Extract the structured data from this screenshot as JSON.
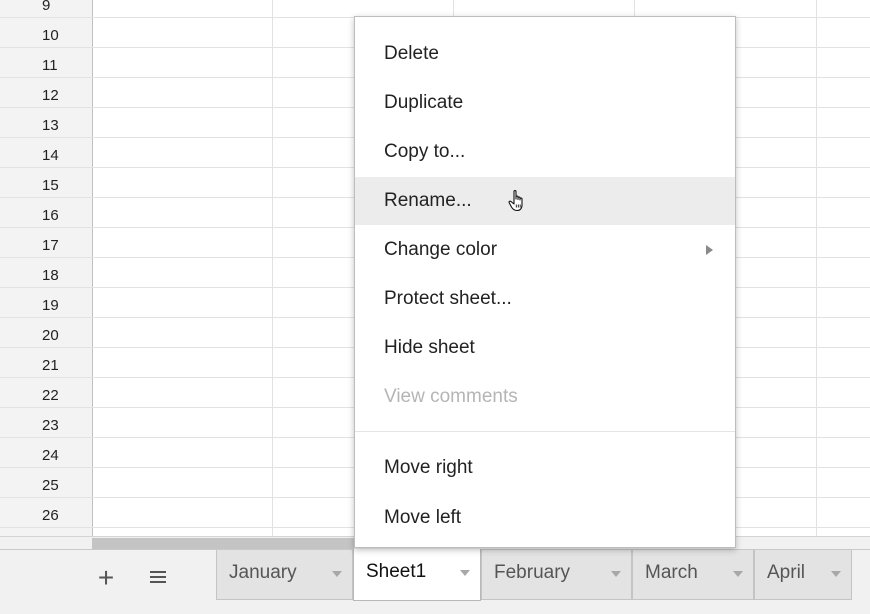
{
  "grid": {
    "row_numbers": [
      "9",
      "10",
      "11",
      "12",
      "13",
      "14",
      "15",
      "16",
      "17",
      "18",
      "19",
      "20",
      "21",
      "22",
      "23",
      "24",
      "25",
      "26"
    ]
  },
  "context_menu": {
    "items": [
      {
        "label": "Delete",
        "state": "normal"
      },
      {
        "label": "Duplicate",
        "state": "normal"
      },
      {
        "label": "Copy to...",
        "state": "normal"
      },
      {
        "label": "Rename...",
        "state": "hover"
      },
      {
        "label": "Change color",
        "state": "submenu"
      },
      {
        "label": "Protect sheet...",
        "state": "normal"
      },
      {
        "label": "Hide sheet",
        "state": "normal"
      },
      {
        "label": "View comments",
        "state": "disabled"
      },
      {
        "label": "Move right",
        "state": "normal"
      },
      {
        "label": "Move left",
        "state": "normal"
      }
    ],
    "submenu_icon": "triangle-right-icon",
    "cursor_icon": "hand-pointer-icon"
  },
  "tabbar": {
    "add_sheet_icon": "plus-icon",
    "add_sheet_label": "+",
    "all_sheets_icon": "list-icon",
    "tabs": [
      {
        "label": "January",
        "active": false
      },
      {
        "label": "Sheet1",
        "active": true
      },
      {
        "label": "February",
        "active": false
      },
      {
        "label": "March",
        "active": false
      },
      {
        "label": "April",
        "active": false
      }
    ]
  },
  "colors": {
    "row_header_bg": "#f3f3f3",
    "gridline": "#e2e2e2",
    "menu_hover": "#ececec",
    "disabled_text": "#b5b5b5",
    "tabbar_bg": "#f1f1f1"
  }
}
